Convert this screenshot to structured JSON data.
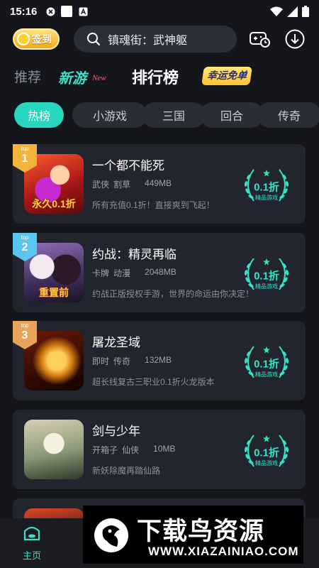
{
  "status_bar": {
    "time": "15:16"
  },
  "header": {
    "checkin_label": "签到",
    "search_text": "镇魂街：武神躯"
  },
  "tabs": {
    "recommend": "推荐",
    "new_games": "新游",
    "new_tag": "New",
    "ranking": "排行榜",
    "lucky": "幸运免单"
  },
  "chips": [
    "热榜",
    "小游戏",
    "三国",
    "回合",
    "传奇"
  ],
  "games": [
    {
      "rank_tag": "top",
      "rank": "1",
      "title": "一个都不能死",
      "tags": [
        "武侠",
        "割草"
      ],
      "size": "449MB",
      "desc": "所有充值0.1折！直接爽到飞起！",
      "discount": "0.1折",
      "discount_sub": "精品游戏",
      "thumb_caption": "永久0.1折",
      "badge_color": "#f4b33a"
    },
    {
      "rank_tag": "top",
      "rank": "2",
      "title": "约战：精灵再临",
      "tags": [
        "卡牌",
        "动漫"
      ],
      "size": "2048MB",
      "desc": "约战正版授权手游，世界的命运由你决定！",
      "discount": "0.1折",
      "discount_sub": "精品游戏",
      "thumb_caption": "重置前",
      "badge_color": "#5ac6f0"
    },
    {
      "rank_tag": "top",
      "rank": "3",
      "title": "屠龙圣域",
      "tags": [
        "即时",
        "传奇"
      ],
      "size": "132MB",
      "desc": "超长线复古三职业0.1折火龙版本",
      "discount": "0.1折",
      "discount_sub": "精品游戏",
      "thumb_caption": "",
      "badge_color": "#e8a35a"
    },
    {
      "rank_tag": "",
      "rank": "",
      "title": "剑与少年",
      "tags": [
        "开箱子",
        "仙侠"
      ],
      "size": "10MB",
      "desc": "新妖除魔再踏仙路",
      "discount": "0.1折",
      "discount_sub": "精品游戏",
      "thumb_caption": "",
      "badge_color": ""
    }
  ],
  "bottom_nav": {
    "home": "主页"
  },
  "watermark": {
    "brand": "下载鸟资源",
    "url": "WWW.XIAZAINIAO.COM"
  }
}
